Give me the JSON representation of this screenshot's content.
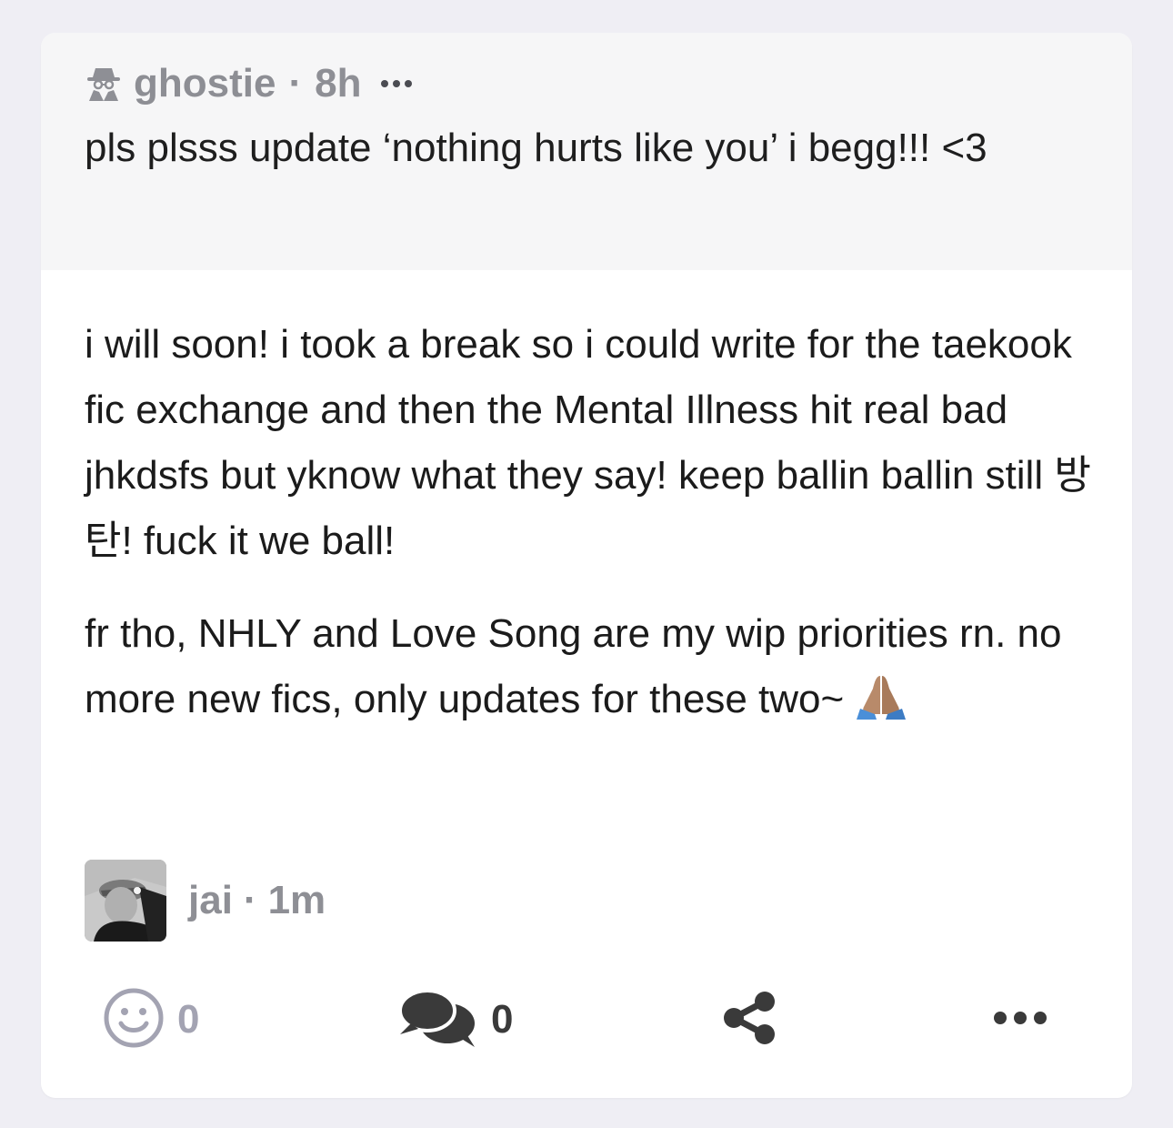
{
  "ask": {
    "asker_name": "ghostie",
    "separator": "·",
    "time": "8h",
    "text": "pls plsss update ‘nothing hurts like you’ i begg!!! <3"
  },
  "answer": {
    "paragraph_1": "i will soon! i took a break so i could write for the taekook fic exchange and then the Mental Illness hit real bad jhkdsfs but yknow what they say! keep ballin ballin still 방탄! fuck it we ball!",
    "paragraph_2": "fr tho, NHLY and Love Song are my wip priorities rn. no more new fics, only updates for these two~"
  },
  "author": {
    "name": "jai",
    "separator": "·",
    "time": "1m"
  },
  "actions": {
    "reactions_count": "0",
    "replies_count": "0"
  },
  "icons": {
    "anon": "anon-spy-icon",
    "emoji": "folded-hands-icon",
    "react": "smiley-icon",
    "reply": "comments-icon",
    "share": "share-icon",
    "more": "more-horizontal-icon"
  },
  "colors": {
    "background": "#efeef4",
    "ask_background": "#f6f6f7",
    "muted_text": "#8e8f95",
    "react_count": "#a3a3b2"
  }
}
